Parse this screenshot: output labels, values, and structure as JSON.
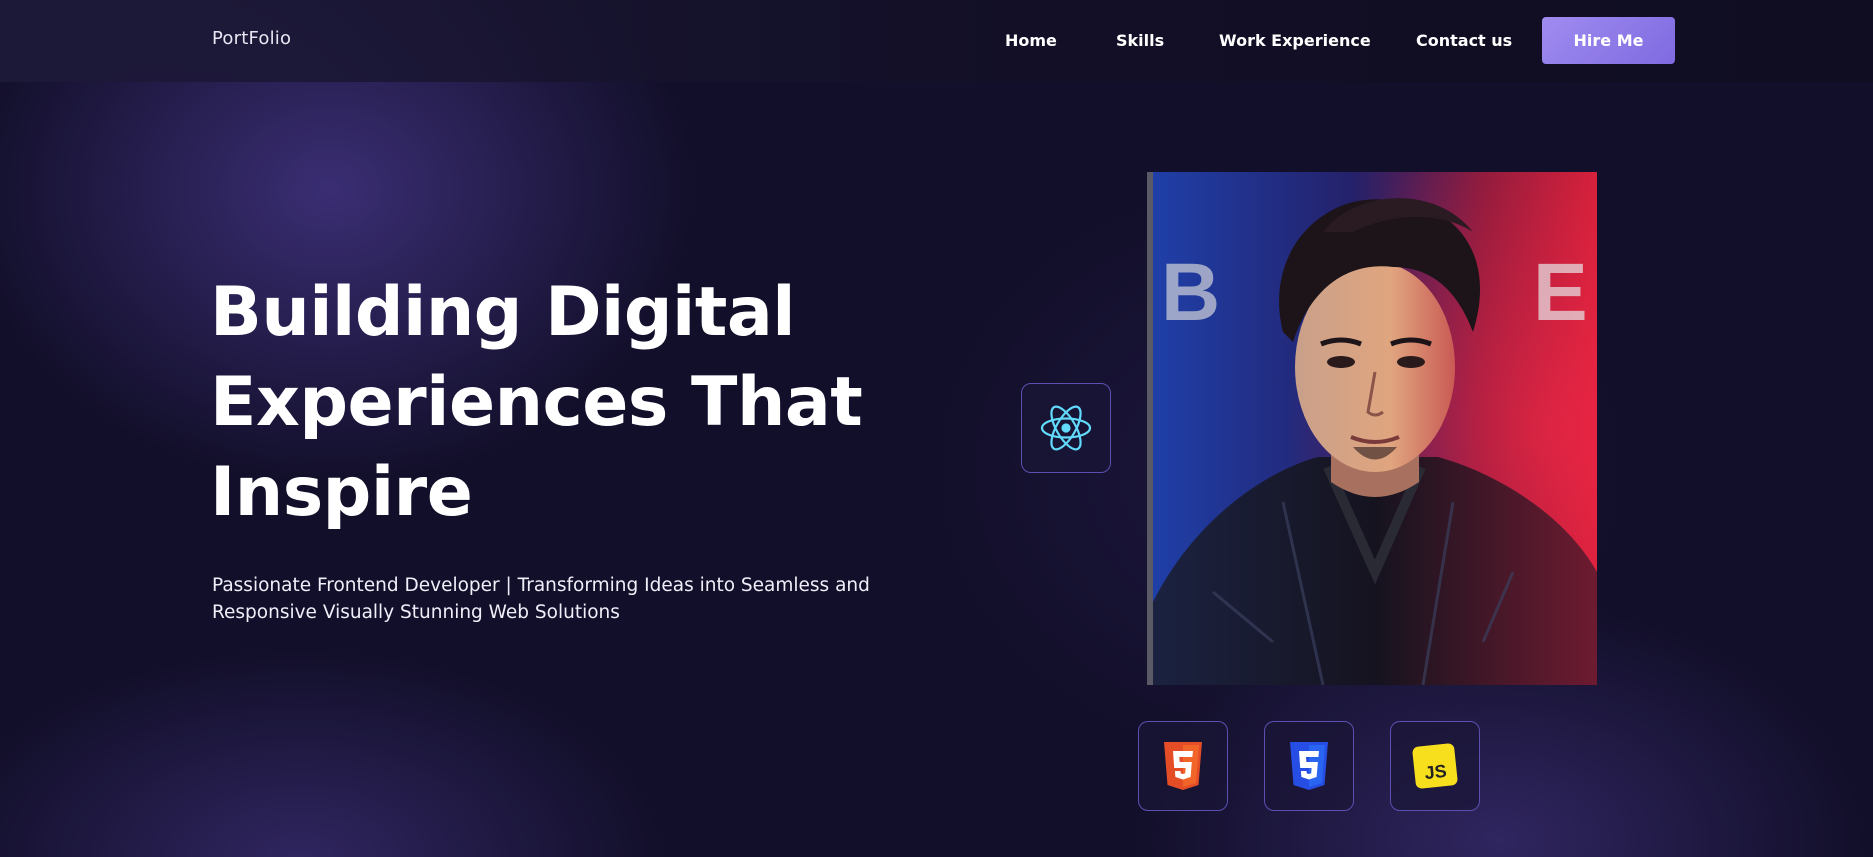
{
  "nav": {
    "logo": "PortFolio",
    "links": [
      {
        "label": "Home"
      },
      {
        "label": "Skills"
      },
      {
        "label": "Work Experience"
      },
      {
        "label": "Contact us"
      }
    ],
    "hire_button": "Hire Me"
  },
  "hero": {
    "title_lines": [
      "Building Digital",
      "Experiences That",
      "Inspire"
    ],
    "subtitle_lines": [
      "Passionate Frontend Developer | Transforming Ideas into Seamless and",
      "Responsive Visually Stunning Web Solutions"
    ],
    "portrait_text": "B E"
  },
  "skills": [
    {
      "name": "react-icon"
    },
    {
      "name": "html5-icon"
    },
    {
      "name": "css3-icon"
    },
    {
      "name": "javascript-icon",
      "label": "JS"
    }
  ],
  "colors": {
    "background": "#120f2a",
    "accent": "#8b76e8",
    "tile_border": "#5b4fb0",
    "react": "#61dafb",
    "html": "#e44d26",
    "css": "#264de4",
    "js": "#f7df1e"
  }
}
